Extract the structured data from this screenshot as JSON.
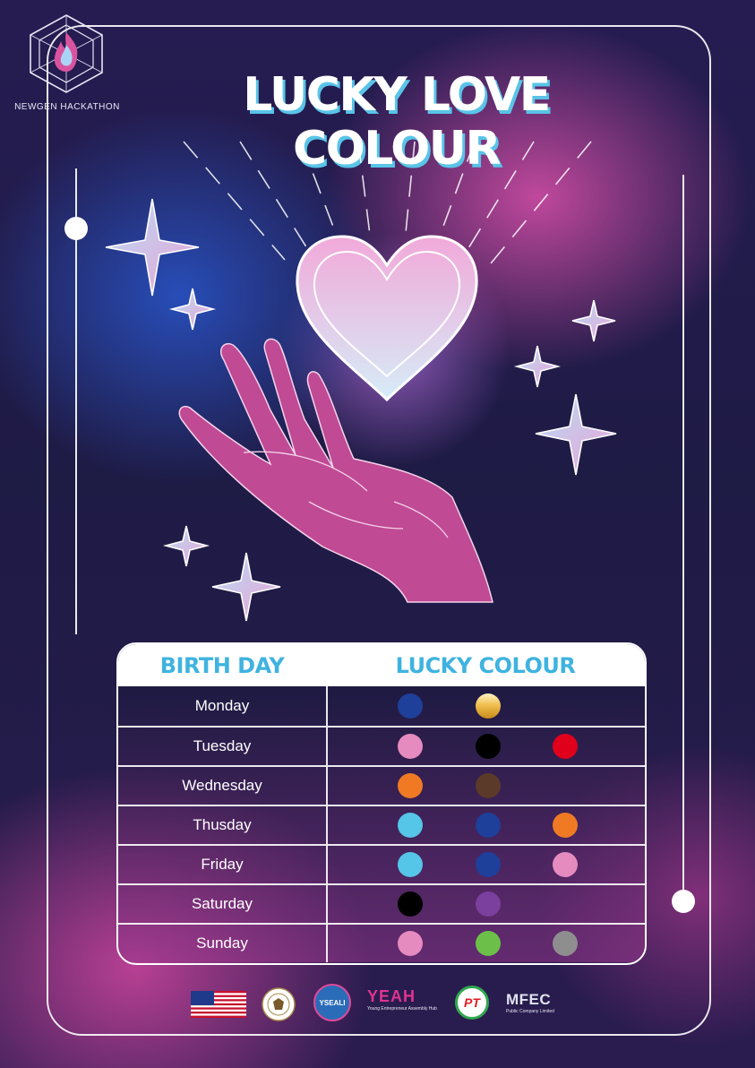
{
  "brand": {
    "name": "NEWGEN HACKATHON"
  },
  "title": "LUCKY LOVE COLOUR",
  "table": {
    "headers": {
      "day": "BIRTH DAY",
      "colour": "LUCKY COLOUR"
    },
    "rows": [
      {
        "day": "Monday",
        "colours": [
          "#1e3f9a",
          "#f0c050"
        ]
      },
      {
        "day": "Tuesday",
        "colours": [
          "#e58bbf",
          "#000000",
          "#e1001c"
        ]
      },
      {
        "day": "Wednesday",
        "colours": [
          "#f07a24",
          "#5b3a29"
        ]
      },
      {
        "day": "Thusday",
        "colours": [
          "#55c5e8",
          "#1e3f9a",
          "#f07a24"
        ]
      },
      {
        "day": "Friday",
        "colours": [
          "#55c5e8",
          "#1e3f9a",
          "#e58bbf"
        ]
      },
      {
        "day": "Saturday",
        "colours": [
          "#000000",
          "#7b3f9e"
        ]
      },
      {
        "day": "Sunday",
        "colours": [
          "#e58bbf",
          "#6cc04a",
          "#8e8e8e"
        ]
      }
    ]
  },
  "sponsors": {
    "yseali": "YSEALI",
    "yeah": "YEAH",
    "yeah_sub": "Young Entrepreneur Assembly Hub",
    "pt": "PT",
    "mfec": "MFEC",
    "mfec_sub": "Public Company Limited"
  },
  "colors": {
    "accent": "#59c4e8",
    "hand": "#c04a94",
    "frame": "#ffffff"
  }
}
